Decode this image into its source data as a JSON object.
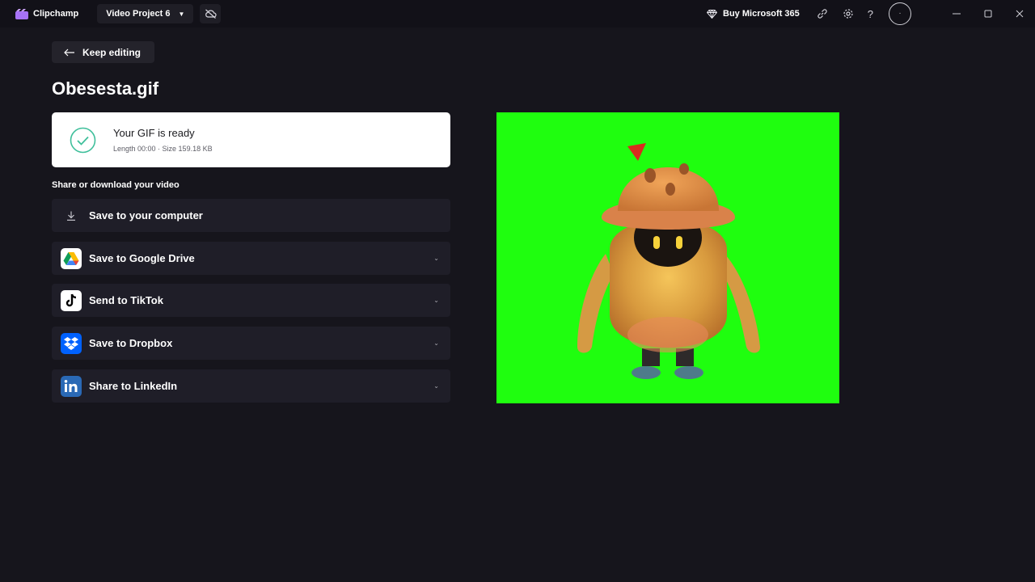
{
  "titlebar": {
    "app_name": "Clipchamp",
    "project_name": "Video Project 6",
    "buy_label": "Buy Microsoft 365",
    "help_label": "?"
  },
  "main": {
    "back_label": "Keep editing",
    "title": "Obesesta.gif",
    "status": {
      "title": "Your GIF is ready",
      "meta": "Length 00:00 · Size 159.18 KB"
    },
    "section_label": "Share or download your video",
    "options": [
      {
        "label": "Save to your computer",
        "icon": "download-icon"
      },
      {
        "label": "Save to Google Drive",
        "icon": "google-drive-icon"
      },
      {
        "label": "Send to TikTok",
        "icon": "tiktok-icon"
      },
      {
        "label": "Save to Dropbox",
        "icon": "dropbox-icon"
      },
      {
        "label": "Share to LinkedIn",
        "icon": "linkedin-icon"
      }
    ]
  },
  "colors": {
    "background": "#16151c",
    "card": "#1f1e28",
    "preview_bg": "#1ffe0f",
    "success": "#3fbf9b",
    "brand": "#8b5cf6"
  }
}
